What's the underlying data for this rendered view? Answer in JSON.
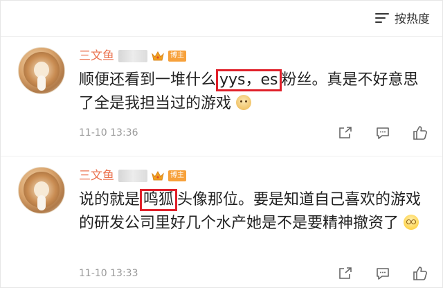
{
  "sort": {
    "label": "按热度"
  },
  "comments": [
    {
      "username": "三文鱼",
      "badge": "博主",
      "text_before": "顺便还看到一堆什么",
      "highlight": "yys，es",
      "text_after": "粉丝。真是不好意思了全是我担当过的游戏",
      "emoji": "doge-emoji",
      "time": "11-10 13:36"
    },
    {
      "username": "三文鱼",
      "badge": "博主",
      "text_before": "说的就是",
      "highlight": "鸣狐",
      "text_after": "头像那位。要是知道自己喜欢的游戏的研发公司里好几个水产她是不是要精神撤资了",
      "emoji": "dizzy-emoji",
      "time": "11-10 13:33"
    }
  ],
  "colors": {
    "username": "#eb7350",
    "badge_bg": "#f7a13b",
    "highlight_border": "#e0202a"
  },
  "icons": [
    "sort-icon",
    "share-icon",
    "comment-icon",
    "like-icon",
    "crown-icon"
  ]
}
